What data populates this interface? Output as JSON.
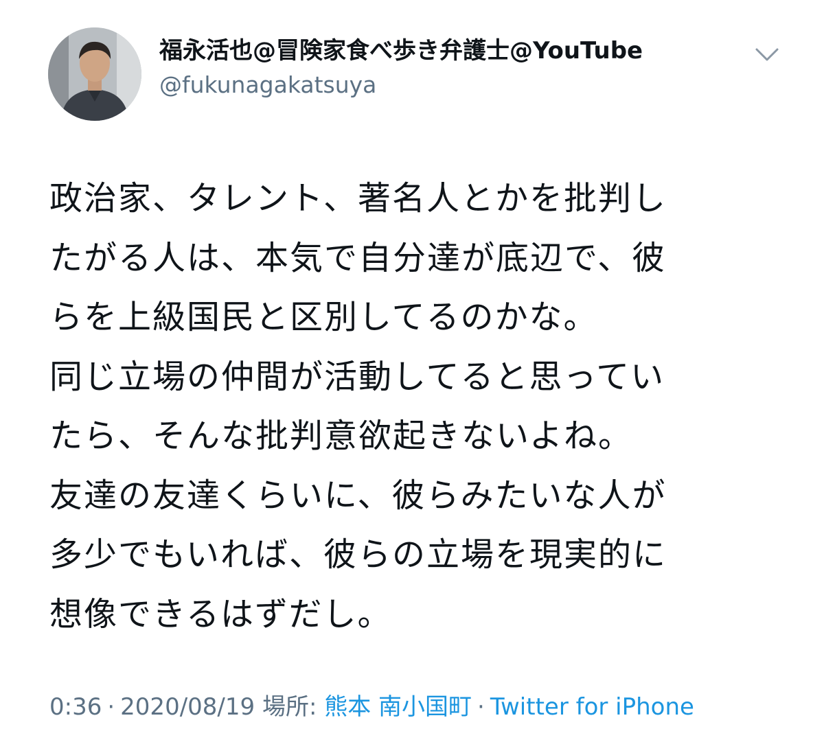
{
  "author": {
    "display_name": "福永活也@冒険家食べ歩き弁護士@YouTube",
    "handle": "@fukunagakatsuya"
  },
  "icons": {
    "avatar": "profile-photo",
    "caret": "chevron-down-icon"
  },
  "tweet": {
    "lines": [
      "政治家、タレント、著名人とかを批判し",
      "たがる人は、本気で自分達が底辺で、彼",
      "らを上級国民と区別してるのかな。",
      "同じ立場の仲間が活動してると思ってい",
      "たら、そんな批判意欲起きないよね。",
      "友達の友達くらいに、彼らみたいな人が",
      "多少でもいれば、彼らの立場を現実的に",
      "想像できるはずだし。"
    ]
  },
  "meta": {
    "time": "0:36",
    "date": "2020/08/19",
    "location_label": "場所:",
    "location": "熊本 南小国町",
    "source": "Twitter for iPhone",
    "separator": "·"
  },
  "colors": {
    "text": "#0f1419",
    "secondary": "#5b7083",
    "link": "#1b95e0",
    "background": "#ffffff"
  }
}
